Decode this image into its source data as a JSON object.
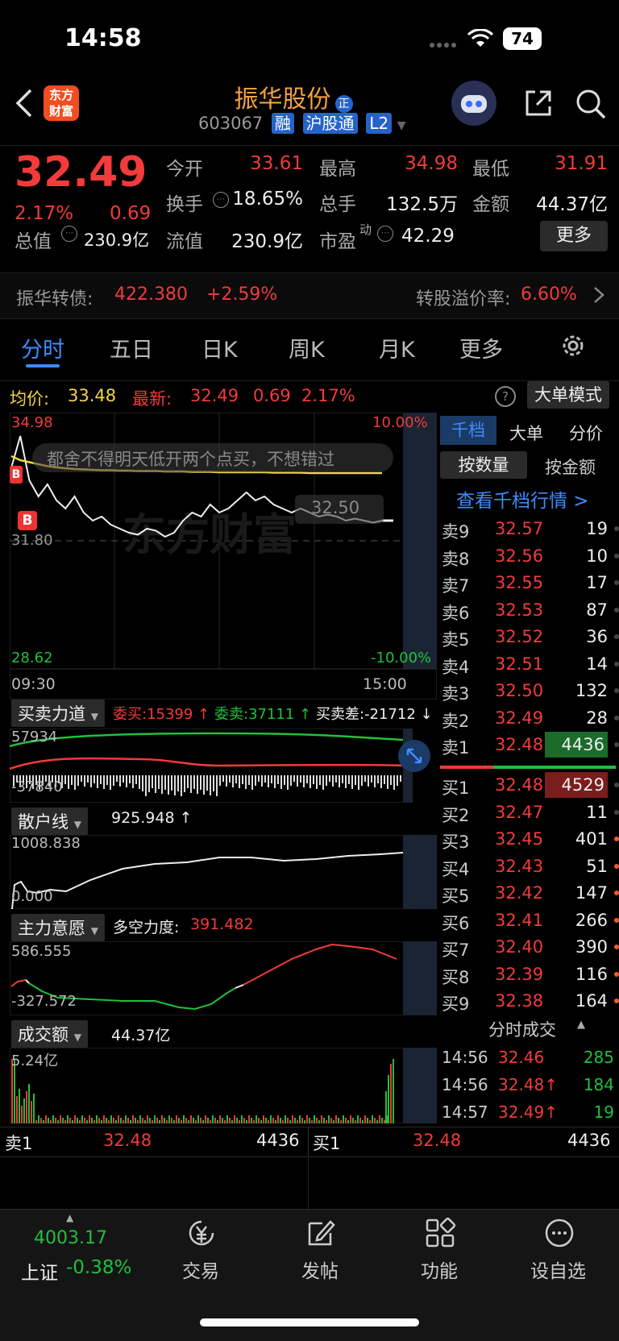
{
  "status": {
    "time": "14:58",
    "battery": "74"
  },
  "header": {
    "logo_line1": "东方",
    "logo_line2": "财富",
    "stock_name": "振华股份",
    "stock_tag": "正",
    "code": "603067",
    "badges": [
      "融",
      "沪股通",
      "L2"
    ]
  },
  "quote": {
    "price": "32.49",
    "pct": "2.17%",
    "change": "0.69",
    "items": [
      {
        "label": "今开",
        "value": "33.61"
      },
      {
        "label": "最高",
        "value": "34.98"
      },
      {
        "label": "最低",
        "value": "31.91"
      },
      {
        "label": "换手",
        "value": "18.65%"
      },
      {
        "label": "总手",
        "value": "132.5万"
      },
      {
        "label": "金额",
        "value": "44.37亿"
      },
      {
        "label": "总值",
        "value": "230.9亿"
      },
      {
        "label": "流值",
        "value": "230.9亿"
      },
      {
        "label": "市盈",
        "value": "42.29"
      }
    ],
    "pe_sup": "动",
    "more": "更多"
  },
  "bond": {
    "name": "振华转债:",
    "price": "422.380",
    "pct": "+2.59%",
    "premium_label": "转股溢价率:",
    "premium": "6.60%"
  },
  "tabs": [
    "分时",
    "五日",
    "日K",
    "周K",
    "月K",
    "更多"
  ],
  "chart_header": {
    "avg_label": "均价:",
    "avg": "33.48",
    "last_label": "最新:",
    "last": "32.49",
    "chg": "0.69",
    "pct": "2.17%",
    "mode_btn": "大单模式"
  },
  "chart_data": {
    "type": "line",
    "title": "",
    "y_high": "34.98",
    "y_low": "28.62",
    "y_mid": "31.80",
    "pct_high": "10.00%",
    "pct_low": "-10.00%",
    "x_start": "09:30",
    "x_end": "15:00",
    "ylim": [
      28.62,
      34.98
    ],
    "series": [
      {
        "name": "",
        "values": [
          33.61,
          34.4,
          33.3,
          32.9,
          33.2,
          32.8,
          32.6,
          32.9,
          32.5,
          32.3,
          32.4,
          32.2,
          32.1,
          32.0,
          31.95,
          32.1,
          32.05,
          31.9,
          32.0,
          32.3,
          32.5,
          32.4,
          32.7,
          32.5,
          32.6,
          32.8,
          33.0,
          32.8,
          32.9,
          32.7,
          32.6,
          32.5,
          32.6,
          32.5,
          32.4,
          32.45,
          32.4,
          32.3,
          32.35,
          32.3,
          32.25,
          32.3
        ]
      },
      {
        "name": "",
        "values": [
          33.9,
          33.8,
          33.75,
          33.7,
          33.65,
          33.62,
          33.6,
          33.58,
          33.57,
          33.56,
          33.55,
          33.55,
          33.54,
          33.54,
          33.53,
          33.53,
          33.53,
          33.52,
          33.52,
          33.52,
          33.51,
          33.51,
          33.51,
          33.5,
          33.5,
          33.5,
          33.5,
          33.5,
          33.5,
          33.49,
          33.49,
          33.49,
          33.49,
          33.48,
          33.48,
          33.48,
          33.48,
          33.48,
          33.48,
          33.48,
          33.48,
          33.48
        ]
      }
    ],
    "watermark": "东方财富",
    "comment": "都舍不得明天低开两个点买，不想错过",
    "price_tag": "32.50",
    "marker": "B"
  },
  "orderbook": {
    "tabs": [
      "千档",
      "大单",
      "分价"
    ],
    "subtabs": [
      "按数量",
      "按金额"
    ],
    "link": "查看千档行情 >",
    "asks": [
      {
        "label": "卖9",
        "price": "32.57",
        "vol": "19"
      },
      {
        "label": "卖8",
        "price": "32.56",
        "vol": "10"
      },
      {
        "label": "卖7",
        "price": "32.55",
        "vol": "17"
      },
      {
        "label": "卖6",
        "price": "32.53",
        "vol": "87"
      },
      {
        "label": "卖5",
        "price": "32.52",
        "vol": "36"
      },
      {
        "label": "卖4",
        "price": "32.51",
        "vol": "14"
      },
      {
        "label": "卖3",
        "price": "32.50",
        "vol": "132"
      },
      {
        "label": "卖2",
        "price": "32.49",
        "vol": "28"
      },
      {
        "label": "卖1",
        "price": "32.48",
        "vol": "4436"
      }
    ],
    "bids": [
      {
        "label": "买1",
        "price": "32.48",
        "vol": "4529"
      },
      {
        "label": "买2",
        "price": "32.47",
        "vol": "11"
      },
      {
        "label": "买3",
        "price": "32.45",
        "vol": "401"
      },
      {
        "label": "买4",
        "price": "32.43",
        "vol": "51"
      },
      {
        "label": "买5",
        "price": "32.42",
        "vol": "147"
      },
      {
        "label": "买6",
        "price": "32.41",
        "vol": "266"
      },
      {
        "label": "买7",
        "price": "32.40",
        "vol": "390"
      },
      {
        "label": "买8",
        "price": "32.39",
        "vol": "116"
      },
      {
        "label": "买9",
        "price": "32.38",
        "vol": "164"
      }
    ],
    "trades_title": "分时成交",
    "trades": [
      {
        "time": "14:56",
        "price": "32.46",
        "vol": "285",
        "arrow": ""
      },
      {
        "time": "14:56",
        "price": "32.48↑",
        "vol": "184",
        "arrow": ""
      },
      {
        "time": "14:57",
        "price": "32.49↑",
        "vol": "19",
        "arrow": ""
      }
    ]
  },
  "ind1": {
    "label": "买卖力道",
    "bid": "委买:15399 ↑",
    "ask": "委卖:37111 ↑",
    "diff": "买卖差:-21712 ↓",
    "top": "57934",
    "bottom": "-37840"
  },
  "ind2": {
    "label": "散户线",
    "value": "925.948 ↑",
    "top": "1008.838",
    "bottom": "0.000"
  },
  "ind3": {
    "label": "主力意愿",
    "value_label": "多空力度:",
    "value": "391.482",
    "top": "586.555",
    "bottom": "-327.572"
  },
  "ind4": {
    "label": "成交额",
    "value": "44.37亿",
    "top": "5.24亿"
  },
  "bottom_quote": {
    "ask_label": "卖1",
    "ask_price": "32.48",
    "ask_vol": "4436",
    "bid_label": "买1",
    "bid_price": "32.48",
    "bid_vol": "4436"
  },
  "nav": {
    "index_value": "4003.17",
    "index_name": "上证",
    "index_pct": "-0.38%",
    "items": [
      "交易",
      "发帖",
      "功能",
      "设自选"
    ]
  }
}
